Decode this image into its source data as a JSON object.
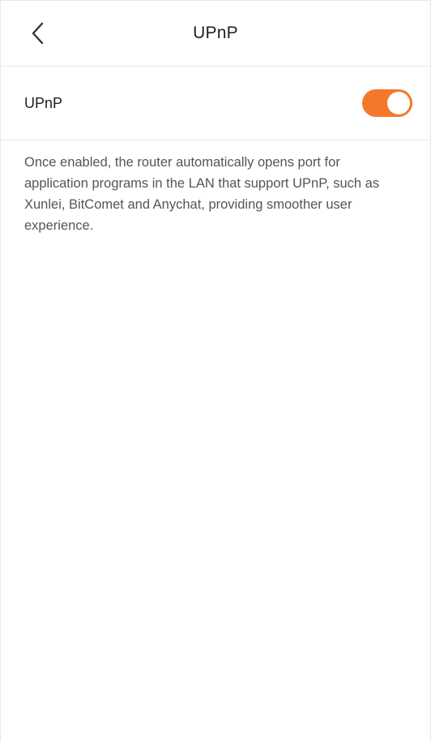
{
  "header": {
    "title": "UPnP",
    "back_icon": "chevron-left-icon"
  },
  "setting": {
    "label": "UPnP",
    "enabled": true
  },
  "description": "Once enabled, the router automatically opens port for application programs in the LAN that support UPnP, such as Xunlei, BitComet and Anychat, providing smoother user experience.",
  "colors": {
    "toggle_on": "#f5782a",
    "toggle_knob": "#ffffff"
  }
}
